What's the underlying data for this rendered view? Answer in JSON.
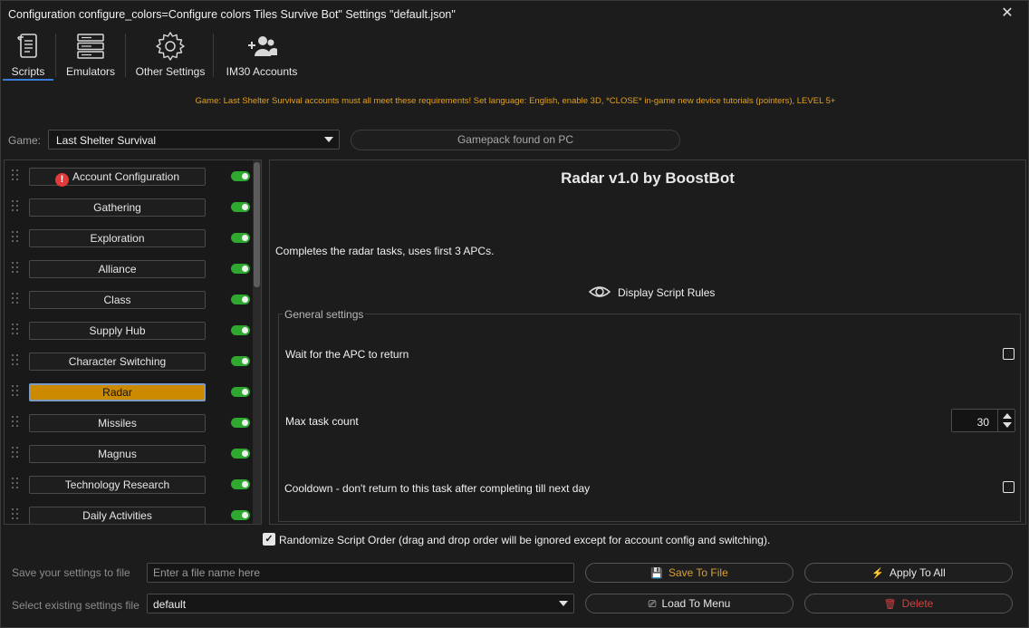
{
  "window": {
    "title": "Configuration configure_colors=Configure colors Tiles Survive Bot\" Settings \"default.json\"",
    "close_glyph": "✕"
  },
  "toolbar": {
    "items": [
      {
        "label": "Scripts",
        "icon": "scroll-icon",
        "active": true
      },
      {
        "label": "Emulators",
        "icon": "server-icon",
        "active": false
      },
      {
        "label": "Other Settings",
        "icon": "gear-icon",
        "active": false
      },
      {
        "label": "IM30 Accounts",
        "icon": "users-add-icon",
        "active": false
      }
    ]
  },
  "notice": "Game: Last Shelter Survival accounts must all meet these requirements! Set language: English, enable 3D, *CLOSE* in-game new device tutorials (pointers), LEVEL 5+",
  "game": {
    "label": "Game:",
    "selected": "Last Shelter Survival",
    "gamepack_status": "Gamepack found on PC"
  },
  "scripts": {
    "items": [
      {
        "label": "Account Configuration",
        "enabled": true,
        "warning": true
      },
      {
        "label": "Gathering",
        "enabled": true
      },
      {
        "label": "Exploration",
        "enabled": true
      },
      {
        "label": "Alliance",
        "enabled": true
      },
      {
        "label": "Class",
        "enabled": true
      },
      {
        "label": "Supply Hub",
        "enabled": true
      },
      {
        "label": "Character Switching",
        "enabled": true
      },
      {
        "label": "Radar",
        "enabled": true,
        "selected": true
      },
      {
        "label": "Missiles",
        "enabled": true
      },
      {
        "label": "Magnus",
        "enabled": true
      },
      {
        "label": "Technology Research",
        "enabled": true
      },
      {
        "label": "Daily Activities",
        "enabled": true
      }
    ],
    "warning_glyph": "!"
  },
  "detail": {
    "title": "Radar v1.0 by BoostBot",
    "description": "Completes the radar tasks, uses first 3 APCs.",
    "rules_link": "Display Script Rules",
    "group_title": "General settings",
    "settings": {
      "wait_apc": {
        "label": "Wait for the APC to return",
        "checked": false
      },
      "max_task": {
        "label": "Max task count",
        "value": "30"
      },
      "cooldown": {
        "label": "Cooldown - don't return to this task after completing till next day",
        "checked": false
      }
    }
  },
  "randomize": {
    "label": "Randomize Script Order (drag and drop order will be ignored except for account config and switching).",
    "checked": true,
    "check_glyph": "✓"
  },
  "save_row": {
    "label": "Save your settings to file",
    "placeholder": "Enter a file name here",
    "save_button": "Save To File",
    "apply_button": "Apply To All"
  },
  "load_row": {
    "label": "Select existing settings file",
    "selected": "default",
    "load_button": "Load To Menu",
    "delete_button": "Delete"
  },
  "colors": {
    "accent": "#cc8a00",
    "toggle_on": "#2fa82f",
    "notice": "#e0a020",
    "tab_underline": "#3b7bd8"
  }
}
